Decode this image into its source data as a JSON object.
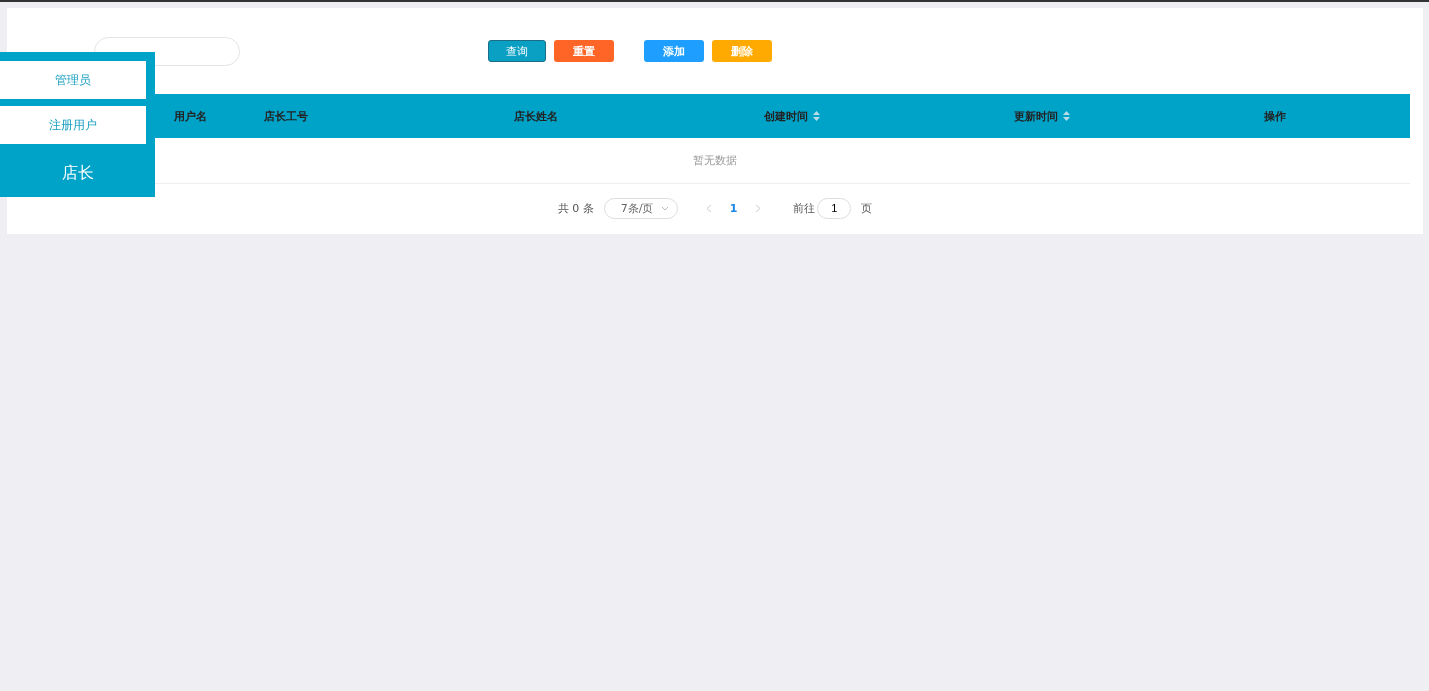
{
  "buttons": [
    {
      "label": "查询",
      "kind": "query"
    },
    {
      "label": "重置",
      "kind": "reset"
    },
    {
      "label": "添加",
      "kind": "add"
    },
    {
      "label": "删除",
      "kind": "delete"
    }
  ],
  "table": {
    "columns": [
      {
        "label": "用户名",
        "sortable": false
      },
      {
        "label": "店长工号",
        "sortable": false
      },
      {
        "label": "店长姓名",
        "sortable": false
      },
      {
        "label": "创建时间",
        "sortable": true
      },
      {
        "label": "更新时间",
        "sortable": true
      },
      {
        "label": "操作",
        "sortable": false
      }
    ],
    "empty_text": "暂无数据"
  },
  "pagination": {
    "total": "共 0 条",
    "page_size": "7条/页",
    "pages": [
      {
        "label": "1",
        "selected": true
      }
    ],
    "goto_label": "前往",
    "goto_value": "1",
    "page_suffix": "页"
  },
  "menu": [
    {
      "label": "管理员",
      "selected": false
    },
    {
      "label": "注册用户",
      "selected": false
    },
    {
      "label": "店长",
      "selected": true
    }
  ]
}
